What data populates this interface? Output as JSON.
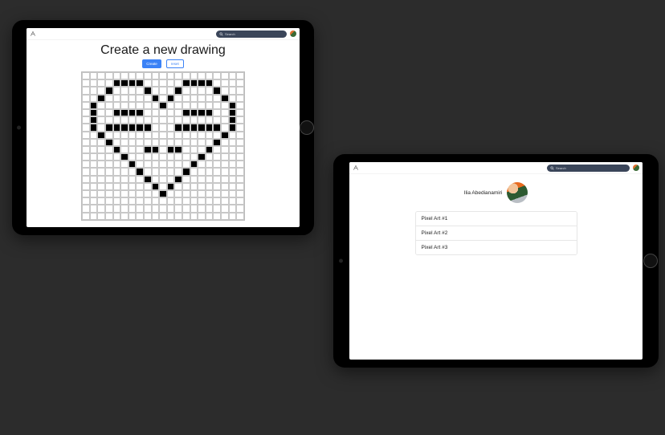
{
  "screen1": {
    "nav": {
      "search_placeholder": "Search"
    },
    "title": "Create a new drawing",
    "buttons": {
      "create": "Create",
      "reset": "reset"
    },
    "grid": {
      "cols": 21,
      "rows": 20,
      "filled": [
        [
          1,
          4
        ],
        [
          1,
          5
        ],
        [
          1,
          6
        ],
        [
          1,
          7
        ],
        [
          1,
          13
        ],
        [
          1,
          14
        ],
        [
          1,
          15
        ],
        [
          1,
          16
        ],
        [
          2,
          3
        ],
        [
          2,
          8
        ],
        [
          2,
          12
        ],
        [
          2,
          17
        ],
        [
          3,
          2
        ],
        [
          3,
          9
        ],
        [
          3,
          11
        ],
        [
          3,
          18
        ],
        [
          4,
          1
        ],
        [
          4,
          10
        ],
        [
          4,
          19
        ],
        [
          5,
          1
        ],
        [
          5,
          4
        ],
        [
          5,
          5
        ],
        [
          5,
          6
        ],
        [
          5,
          7
        ],
        [
          5,
          13
        ],
        [
          5,
          14
        ],
        [
          5,
          15
        ],
        [
          5,
          16
        ],
        [
          5,
          19
        ],
        [
          6,
          1
        ],
        [
          6,
          19
        ],
        [
          7,
          1
        ],
        [
          7,
          3
        ],
        [
          7,
          4
        ],
        [
          7,
          5
        ],
        [
          7,
          6
        ],
        [
          7,
          7
        ],
        [
          7,
          8
        ],
        [
          7,
          12
        ],
        [
          7,
          13
        ],
        [
          7,
          14
        ],
        [
          7,
          15
        ],
        [
          7,
          16
        ],
        [
          7,
          17
        ],
        [
          7,
          19
        ],
        [
          8,
          2
        ],
        [
          8,
          18
        ],
        [
          9,
          3
        ],
        [
          9,
          17
        ],
        [
          10,
          4
        ],
        [
          10,
          8
        ],
        [
          10,
          9
        ],
        [
          10,
          11
        ],
        [
          10,
          12
        ],
        [
          10,
          16
        ],
        [
          11,
          5
        ],
        [
          11,
          15
        ],
        [
          12,
          6
        ],
        [
          12,
          14
        ],
        [
          13,
          7
        ],
        [
          13,
          13
        ],
        [
          14,
          8
        ],
        [
          14,
          12
        ],
        [
          15,
          9
        ],
        [
          15,
          11
        ],
        [
          16,
          10
        ]
      ]
    }
  },
  "screen2": {
    "nav": {
      "search_placeholder": "Search"
    },
    "profile": {
      "name": "Ilia Abedianamiri"
    },
    "items": [
      "Pixel Art #1",
      "Pixel Art #2",
      "Pixel Art #3"
    ]
  }
}
